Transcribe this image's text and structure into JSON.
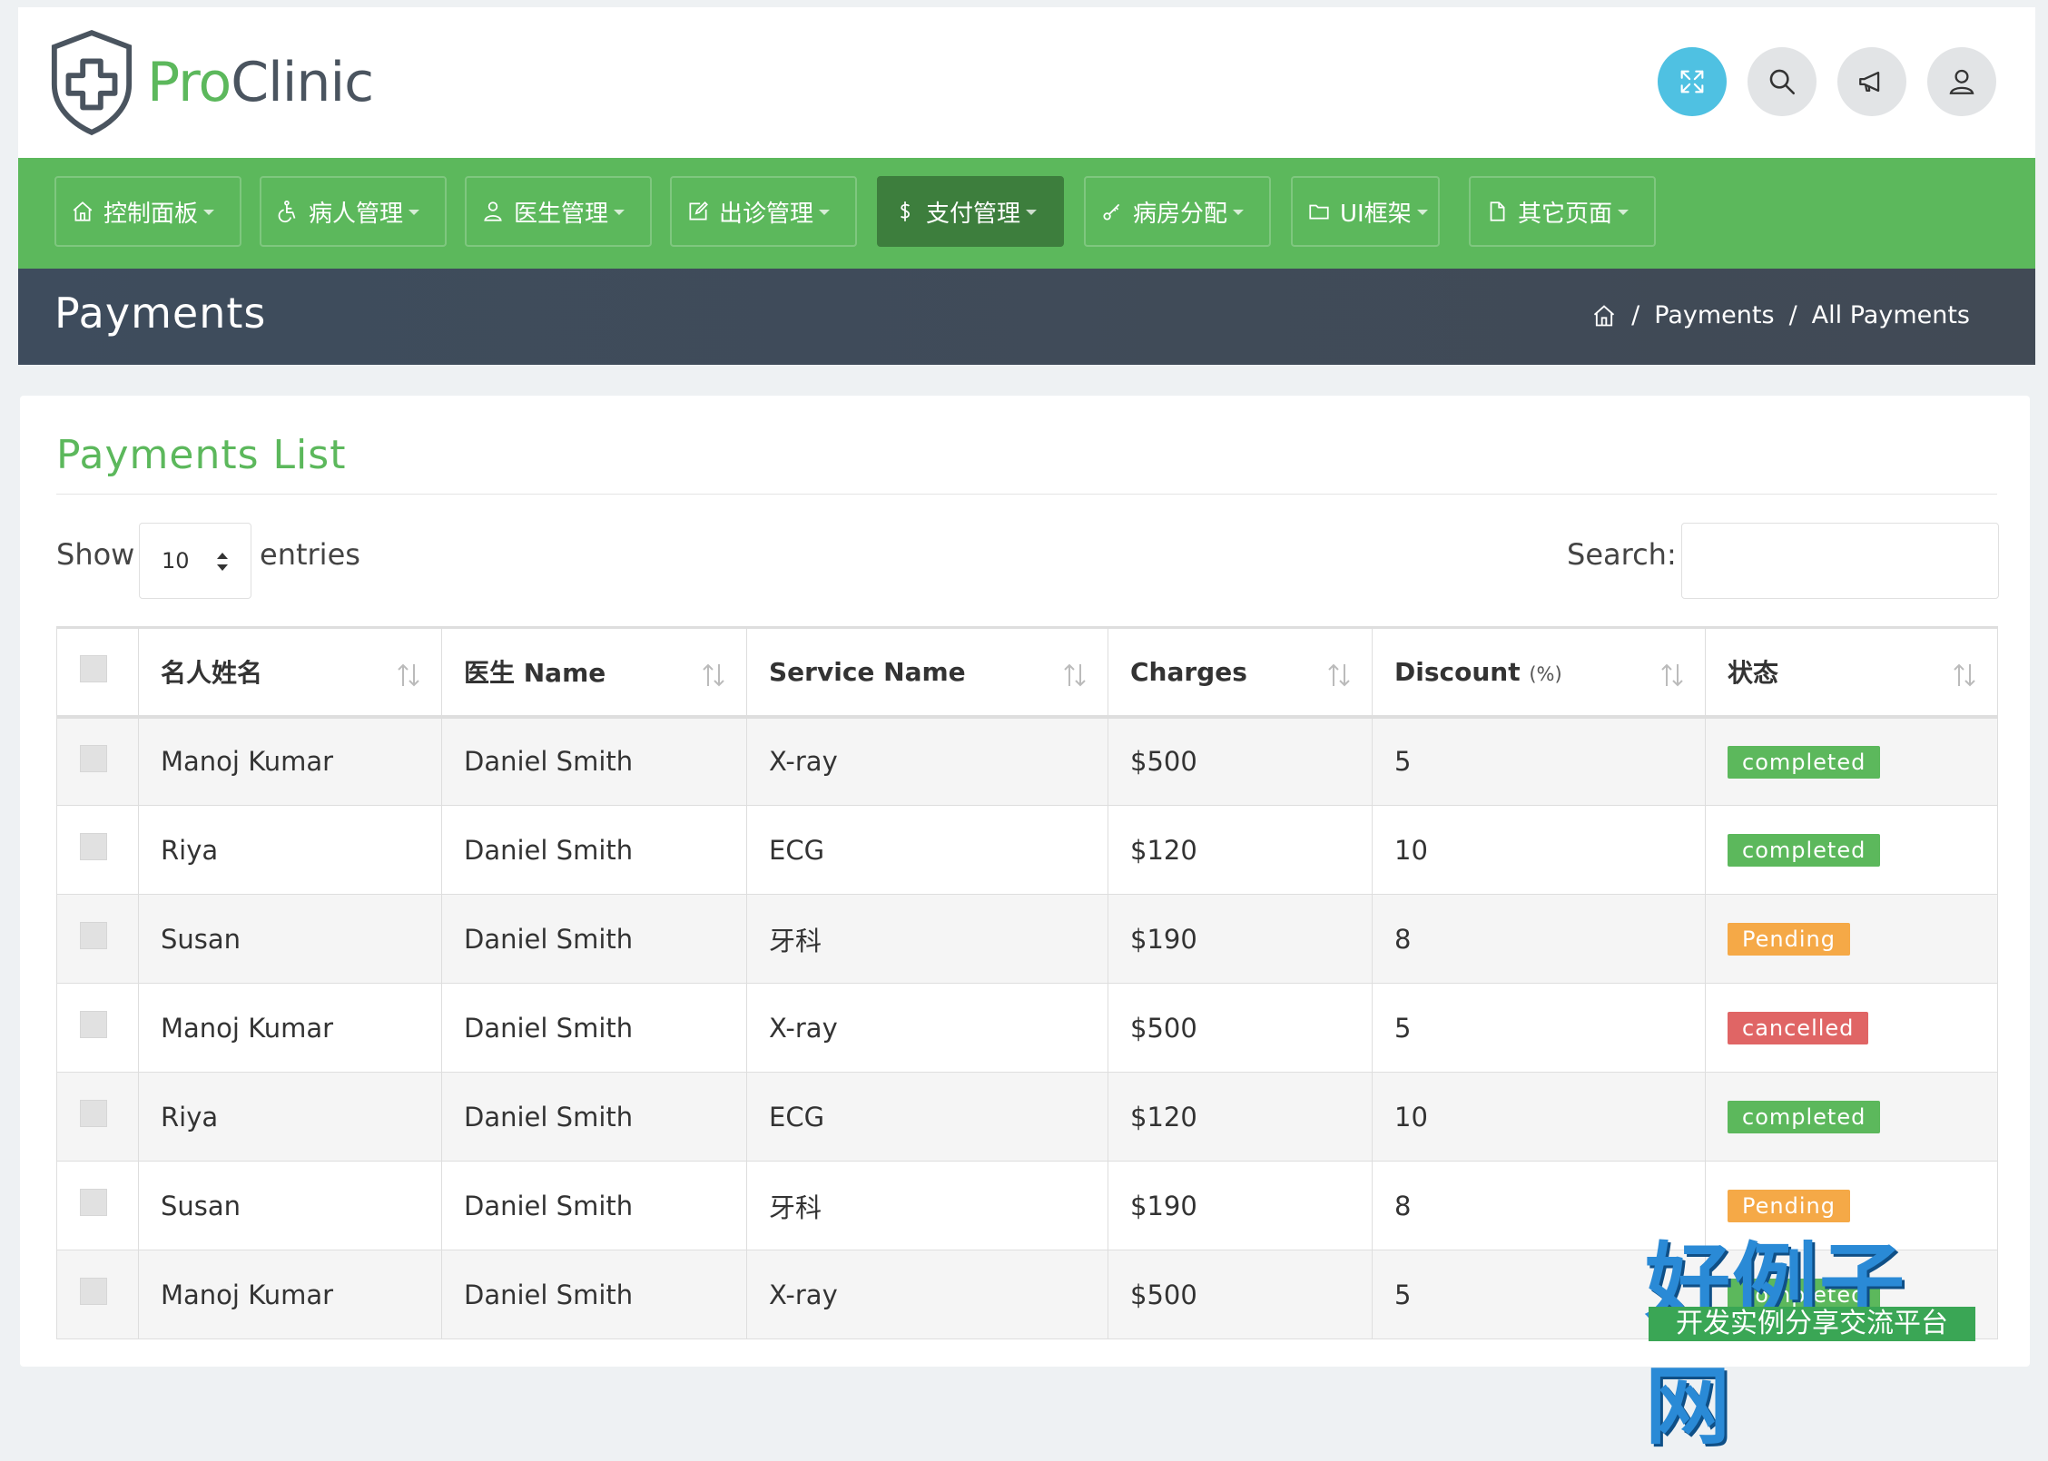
{
  "brand": {
    "name_part1": "Pro",
    "name_part2": "Clinic"
  },
  "header_buttons": [
    {
      "name": "fullscreen-icon"
    },
    {
      "name": "search-icon"
    },
    {
      "name": "megaphone-icon"
    },
    {
      "name": "user-icon"
    }
  ],
  "nav": [
    {
      "label": "控制面板",
      "icon": "home-icon"
    },
    {
      "label": "病人管理",
      "icon": "wheelchair-icon"
    },
    {
      "label": "医生管理",
      "icon": "doctor-icon"
    },
    {
      "label": "出诊管理",
      "icon": "edit-icon"
    },
    {
      "label": "支付管理",
      "icon": "dollar-icon",
      "active": true
    },
    {
      "label": "病房分配",
      "icon": "key-icon"
    },
    {
      "label": "UI框架",
      "icon": "folder-icon"
    },
    {
      "label": "其它页面",
      "icon": "file-icon"
    }
  ],
  "page": {
    "title": "Payments",
    "breadcrumb": [
      "Payments",
      "All Payments"
    ]
  },
  "card": {
    "title": "Payments List",
    "show_label": "Show",
    "entries_value": "10",
    "entries_label": "entries",
    "search_label": "Search:",
    "search_value": ""
  },
  "table": {
    "headers": [
      "名人姓名",
      "医生 Name",
      "Service Name",
      "Charges",
      "Discount",
      "状态"
    ],
    "discount_unit": "(%)",
    "rows": [
      {
        "patient": "Manoj Kumar",
        "doctor": "Daniel Smith",
        "service": "X-ray",
        "charges": "$500",
        "discount": "5",
        "status": "completed"
      },
      {
        "patient": "Riya",
        "doctor": "Daniel Smith",
        "service": "ECG",
        "charges": "$120",
        "discount": "10",
        "status": "completed"
      },
      {
        "patient": "Susan",
        "doctor": "Daniel Smith",
        "service": "牙科",
        "charges": "$190",
        "discount": "8",
        "status": "Pending"
      },
      {
        "patient": "Manoj Kumar",
        "doctor": "Daniel Smith",
        "service": "X-ray",
        "charges": "$500",
        "discount": "5",
        "status": "cancelled"
      },
      {
        "patient": "Riya",
        "doctor": "Daniel Smith",
        "service": "ECG",
        "charges": "$120",
        "discount": "10",
        "status": "completed"
      },
      {
        "patient": "Susan",
        "doctor": "Daniel Smith",
        "service": "牙科",
        "charges": "$190",
        "discount": "8",
        "status": "Pending"
      },
      {
        "patient": "Manoj Kumar",
        "doctor": "Daniel Smith",
        "service": "X-ray",
        "charges": "$500",
        "discount": "5",
        "status": "completed"
      }
    ]
  },
  "status_colors": {
    "completed": "#5cb85c",
    "Pending": "#f5a947",
    "cancelled": "#e06565"
  },
  "colors": {
    "brand_green": "#5cb85c",
    "title_bar": "#414a55",
    "active_header_button": "#4fc1e2"
  },
  "watermark": {
    "big": "好例子网",
    "small": "开发实例分享交流平台"
  }
}
